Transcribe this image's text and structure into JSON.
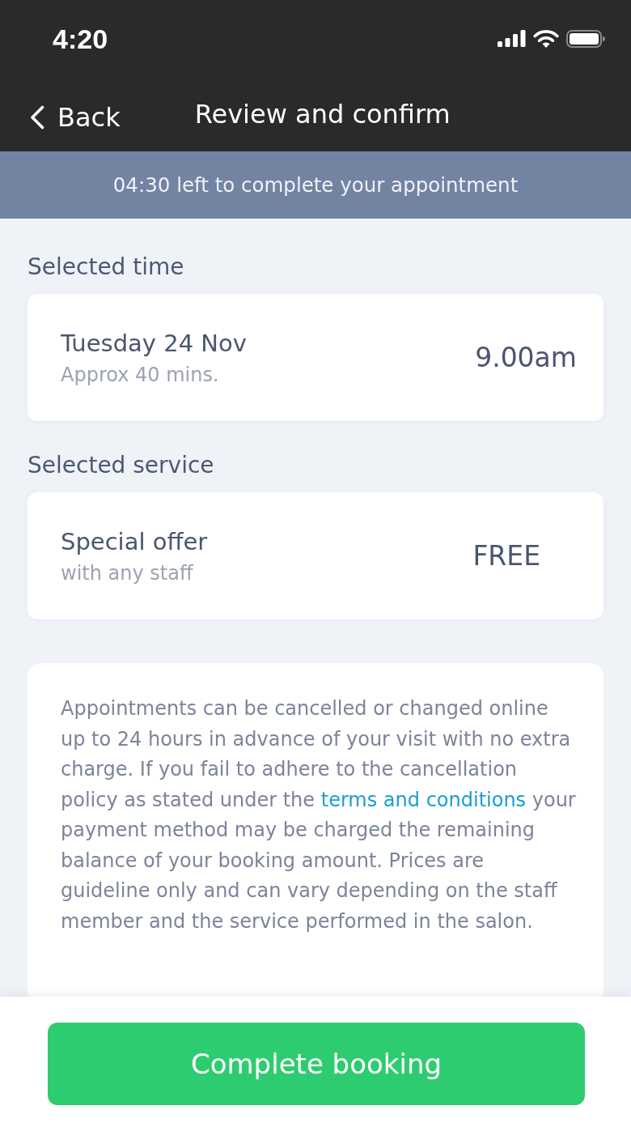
{
  "status_bar": {
    "time": "4:20"
  },
  "nav": {
    "back_label": "Back",
    "title": "Review and confirm"
  },
  "timer_banner": {
    "text": "04:30 left to complete your appointment"
  },
  "sections": [
    {
      "kind": "time",
      "heading": "Selected time",
      "title": "Tuesday 24 Nov",
      "subtitle": "Approx 40 mins.",
      "value": "9.00am"
    },
    {
      "kind": "price",
      "heading": "Selected service",
      "title": "Special offer",
      "subtitle": "with any staff",
      "value": "FREE"
    }
  ],
  "policy": {
    "text_before": "Appointments can be cancelled or changed online up to 24 hours in advance of your visit with no extra charge. If you fail to adhere to the cancellation policy as stated under the",
    "link": "terms and conditions",
    "text_after": "your payment method may be charged the remaining balance of your booking amount. Prices are guideline only and can vary depending on the staff member and the service performed in the salon."
  },
  "primary_button": {
    "label": "Complete booking"
  }
}
